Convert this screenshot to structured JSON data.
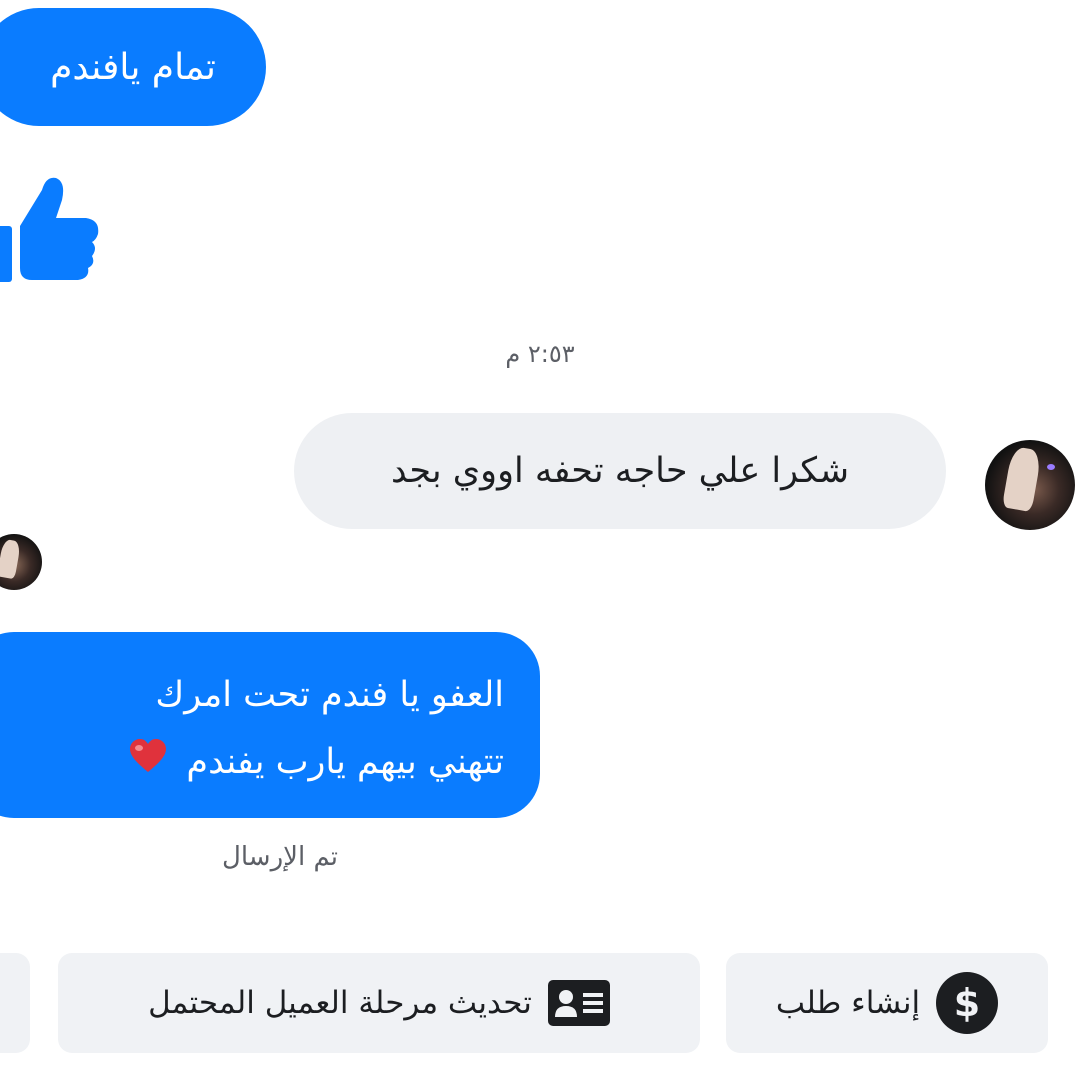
{
  "messages": {
    "sent_1": "تمام يافندم",
    "timestamp": "٢:٥٣ م",
    "received_1": "شكرا علي حاجه تحفه اووي بجد",
    "sent_2_line1": "العفو يا فندم تحت امرك",
    "sent_2_line2": "تتهني بيهم يارب يفندم",
    "status": "تم الإرسال"
  },
  "actions": {
    "update_stage": "تحديث مرحلة العميل المحتمل",
    "create_order": "إنشاء طلب"
  },
  "icons": {
    "like": "thumbs-up-icon",
    "heart": "heart-icon",
    "contact_card": "contact-card-icon",
    "dollar": "dollar-icon"
  },
  "colors": {
    "outgoing_bubble": "#0a7cff",
    "incoming_bubble": "#eef0f3",
    "action_button": "#f0f2f5",
    "heart": "#e0323c"
  }
}
